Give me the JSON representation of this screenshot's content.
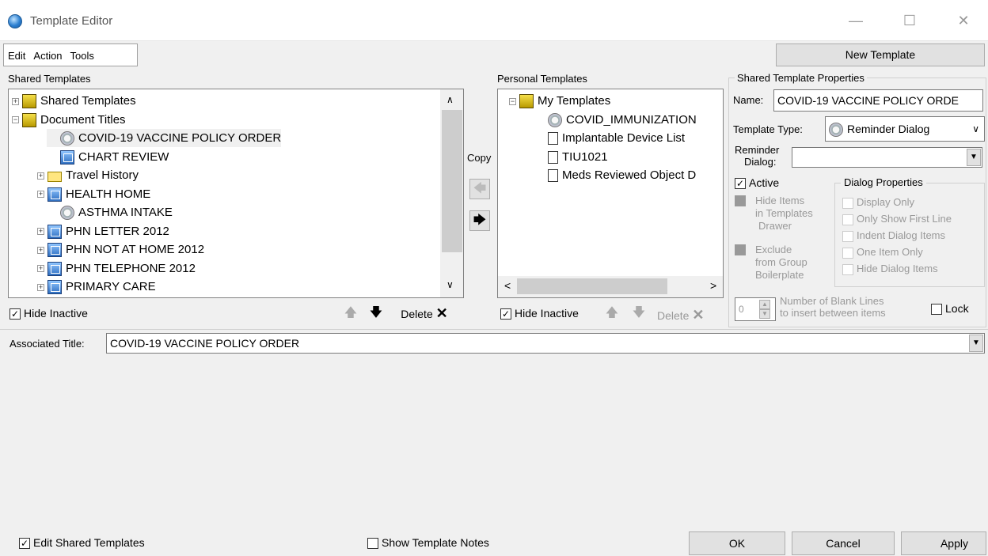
{
  "window": {
    "title": "Template Editor",
    "minimize": "—",
    "maximize": "☐",
    "close": "✕"
  },
  "menu": [
    "Edit",
    "Action",
    "Tools"
  ],
  "new_template_label": "New Template",
  "shared": {
    "label": "Shared Templates",
    "items": [
      {
        "label": "Shared Templates",
        "icon": "drawer-icon",
        "expander": "+"
      },
      {
        "label": "Document Titles",
        "icon": "drawer-icon",
        "expander": "−"
      },
      {
        "label": "COVID-19 VACCINE POLICY ORDER",
        "icon": "reminder-dialog-icon",
        "expander": ""
      },
      {
        "label": "CHART REVIEW",
        "icon": "template-icon",
        "expander": ""
      },
      {
        "label": "Travel History",
        "icon": "folder-icon",
        "expander": "+"
      },
      {
        "label": "HEALTH HOME",
        "icon": "template-icon",
        "expander": "+"
      },
      {
        "label": "ASTHMA INTAKE",
        "icon": "reminder-dialog-icon",
        "expander": ""
      },
      {
        "label": "PHN LETTER 2012",
        "icon": "template-icon",
        "expander": "+"
      },
      {
        "label": "PHN NOT AT HOME 2012",
        "icon": "template-icon",
        "expander": "+"
      },
      {
        "label": "PHN TELEPHONE 2012",
        "icon": "template-icon",
        "expander": "+"
      },
      {
        "label": "PRIMARY CARE",
        "icon": "template-icon",
        "expander": "+"
      }
    ],
    "hide_inactive": "Hide Inactive",
    "delete": "Delete"
  },
  "copy_label": "Copy",
  "personal": {
    "label": "Personal Templates",
    "items": [
      {
        "label": "My Templates",
        "icon": "drawer-icon",
        "expander": "−"
      },
      {
        "label": "COVID_IMMUNIZATION",
        "icon": "reminder-dialog-icon",
        "expander": ""
      },
      {
        "label": "Implantable Device List",
        "icon": "document-icon",
        "expander": ""
      },
      {
        "label": "TIU1021",
        "icon": "document-icon",
        "expander": ""
      },
      {
        "label": "Meds Reviewed Object D",
        "icon": "document-icon",
        "expander": ""
      }
    ],
    "hide_inactive": "Hide Inactive",
    "delete": "Delete"
  },
  "props": {
    "group": "Shared Template Properties",
    "name_label": "Name:",
    "name_value": "COVID-19 VACCINE POLICY ORDE",
    "type_label": "Template Type:",
    "type_value": "Reminder Dialog",
    "reminder_label1": "Reminder",
    "reminder_label2": "Dialog:",
    "reminder_value": "",
    "active": "Active",
    "hide_items": [
      "Hide Items",
      "in Templates",
      "Drawer"
    ],
    "exclude": [
      "Exclude",
      "from Group",
      "Boilerplate"
    ],
    "dialog_group": "Dialog Properties",
    "dialog_opts": [
      "Display Only",
      "Only Show First Line",
      "Indent Dialog Items",
      "One Item Only",
      "Hide Dialog Items"
    ],
    "blank_value": "0",
    "blank_label1": "Number of Blank Lines",
    "blank_label2": "to insert between items",
    "lock": "Lock"
  },
  "assoc": {
    "label": "Associated Title:",
    "value": "COVID-19 VACCINE POLICY ORDER"
  },
  "footer": {
    "edit_shared": "Edit Shared Templates",
    "show_notes": "Show Template Notes",
    "ok": "OK",
    "cancel": "Cancel",
    "apply": "Apply"
  }
}
